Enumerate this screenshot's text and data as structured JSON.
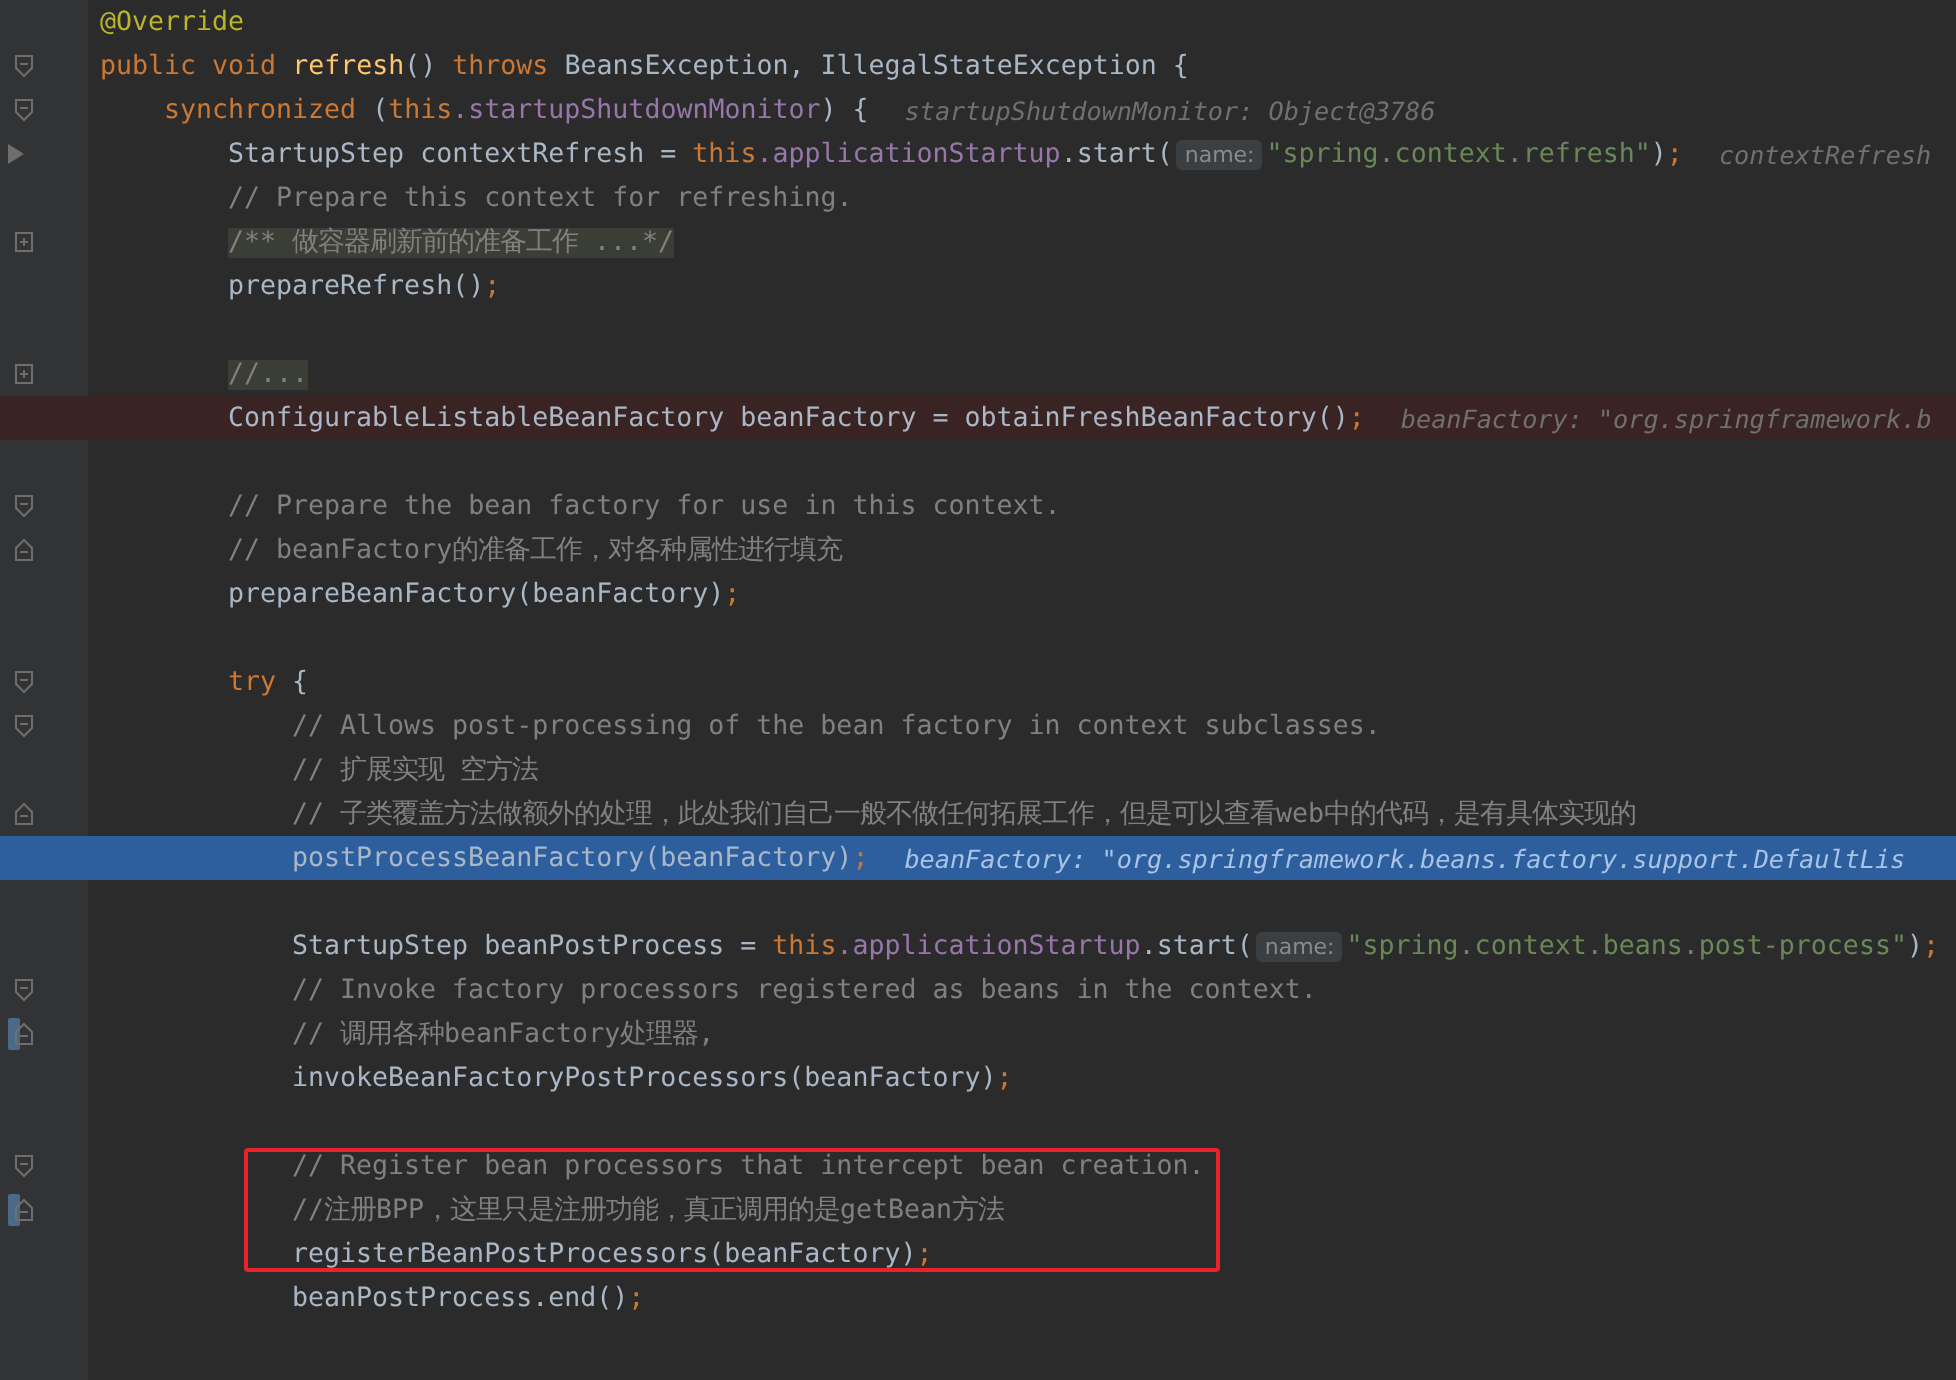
{
  "editor": {
    "lines": [
      {
        "kind": "code",
        "boxed": false,
        "segments": [
          {
            "kind": "code",
            "tokens": [
              {
                "kind": "annotation",
                "text": "@Override"
              }
            ]
          }
        ]
      },
      {
        "kind": "code",
        "boxed": false,
        "gutter": [
          {
            "kind": "fold-start"
          }
        ],
        "segments": [
          {
            "kind": "code",
            "tokens": [
              {
                "kind": "keyword",
                "text": "public void "
              },
              {
                "kind": "method",
                "text": "refresh"
              },
              {
                "kind": "plain",
                "text": "() "
              },
              {
                "kind": "keyword",
                "text": "throws "
              },
              {
                "kind": "plain",
                "text": "BeansException, IllegalStateException {"
              }
            ]
          }
        ],
        "children": [
          {
            "kind": "code",
            "boxed": false,
            "gutter": [
              {
                "kind": "fold-start"
              }
            ],
            "segments": [
              {
                "kind": "code",
                "tokens": [
                  {
                    "kind": "keyword",
                    "text": "synchronized "
                  },
                  {
                    "kind": "plain",
                    "text": "("
                  },
                  {
                    "kind": "keyword",
                    "text": "this"
                  },
                  {
                    "kind": "field",
                    "text": ".startupShutdownMonitor"
                  },
                  {
                    "kind": "plain",
                    "text": ") {"
                  }
                ]
              },
              {
                "kind": "value",
                "text": "startupShutdownMonitor: Object@3786"
              }
            ],
            "children": [
              {
                "kind": "code",
                "boxed": false,
                "gutter": [
                  {
                    "kind": "arrow"
                  }
                ],
                "segments": [
                  {
                    "kind": "code",
                    "tokens": [
                      {
                        "kind": "plain",
                        "text": "StartupStep contextRefresh = "
                      },
                      {
                        "kind": "keyword",
                        "text": "this"
                      },
                      {
                        "kind": "field",
                        "text": ".applicationStartup"
                      },
                      {
                        "kind": "plain",
                        "text": ".start("
                      }
                    ]
                  },
                  {
                    "kind": "hint",
                    "text": "name:"
                  },
                  {
                    "kind": "code",
                    "tokens": [
                      {
                        "kind": "string",
                        "text": "\"spring.context.refresh\""
                      },
                      {
                        "kind": "plain",
                        "text": ")"
                      },
                      {
                        "kind": "keyword",
                        "text": ";"
                      }
                    ]
                  },
                  {
                    "kind": "value",
                    "text": "contextRefresh"
                  }
                ]
              },
              {
                "kind": "code",
                "boxed": false,
                "segments": [
                  {
                    "kind": "code",
                    "tokens": [
                      {
                        "kind": "comment",
                        "text": "// Prepare this context for refreshing."
                      }
                    ]
                  }
                ]
              },
              {
                "kind": "code",
                "boxed": false,
                "gutter": [
                  {
                    "kind": "expand"
                  }
                ],
                "segments": [
                  {
                    "kind": "code",
                    "tokens": [
                      {
                        "kind": "folded",
                        "text": "/** 做容器刷新前的准备工作 ...*/"
                      }
                    ]
                  }
                ]
              },
              {
                "kind": "code",
                "boxed": false,
                "segments": [
                  {
                    "kind": "code",
                    "tokens": [
                      {
                        "kind": "plain",
                        "text": "prepareRefresh()"
                      },
                      {
                        "kind": "keyword",
                        "text": ";"
                      }
                    ]
                  }
                ]
              },
              {
                "kind": "blank",
                "boxed": false
              },
              {
                "kind": "code",
                "boxed": false,
                "gutter": [
                  {
                    "kind": "expand"
                  }
                ],
                "segments": [
                  {
                    "kind": "code",
                    "tokens": [
                      {
                        "kind": "folded",
                        "text": "//..."
                      }
                    ]
                  }
                ]
              },
              {
                "kind": "breakpoint",
                "boxed": false,
                "segments": [
                  {
                    "kind": "code",
                    "tokens": [
                      {
                        "kind": "plain",
                        "text": "ConfigurableListableBeanFactory beanFactory = obtainFreshBeanFactory()"
                      },
                      {
                        "kind": "keyword",
                        "text": ";"
                      }
                    ]
                  },
                  {
                    "kind": "value",
                    "text": "beanFactory: \"org.springframework.b"
                  }
                ]
              },
              {
                "kind": "blank",
                "boxed": false
              },
              {
                "kind": "code",
                "boxed": false,
                "gutter": [
                  {
                    "kind": "fold-start"
                  }
                ],
                "segments": [
                  {
                    "kind": "code",
                    "tokens": [
                      {
                        "kind": "comment",
                        "text": "// Prepare the bean factory for use in this context."
                      }
                    ]
                  }
                ]
              },
              {
                "kind": "code",
                "boxed": false,
                "gutter": [
                  {
                    "kind": "fold-end"
                  }
                ],
                "segments": [
                  {
                    "kind": "code",
                    "tokens": [
                      {
                        "kind": "comment",
                        "text": "// beanFactory的准备工作，对各种属性进行填充"
                      }
                    ]
                  }
                ]
              },
              {
                "kind": "code",
                "boxed": false,
                "segments": [
                  {
                    "kind": "code",
                    "tokens": [
                      {
                        "kind": "plain",
                        "text": "prepareBeanFactory(beanFactory)"
                      },
                      {
                        "kind": "keyword",
                        "text": ";"
                      }
                    ]
                  }
                ]
              },
              {
                "kind": "blank",
                "boxed": false
              },
              {
                "kind": "code",
                "boxed": false,
                "gutter": [
                  {
                    "kind": "fold-start"
                  }
                ],
                "segments": [
                  {
                    "kind": "code",
                    "tokens": [
                      {
                        "kind": "keyword",
                        "text": "try "
                      },
                      {
                        "kind": "plain",
                        "text": "{"
                      }
                    ]
                  }
                ],
                "children": [
                  {
                    "kind": "code",
                    "boxed": false,
                    "gutter": [
                      {
                        "kind": "fold-start"
                      }
                    ],
                    "segments": [
                      {
                        "kind": "code",
                        "tokens": [
                          {
                            "kind": "comment",
                            "text": "// Allows post-processing of the bean factory in context subclasses."
                          }
                        ]
                      }
                    ]
                  },
                  {
                    "kind": "code",
                    "boxed": false,
                    "segments": [
                      {
                        "kind": "code",
                        "tokens": [
                          {
                            "kind": "comment",
                            "text": "// 扩展实现 空方法"
                          }
                        ]
                      }
                    ]
                  },
                  {
                    "kind": "code",
                    "boxed": false,
                    "gutter": [
                      {
                        "kind": "fold-end"
                      }
                    ],
                    "segments": [
                      {
                        "kind": "code",
                        "tokens": [
                          {
                            "kind": "comment",
                            "text": "// 子类覆盖方法做额外的处理，此处我们自己一般不做任何拓展工作，但是可以查看web中的代码，是有具体实现的"
                          }
                        ]
                      }
                    ]
                  },
                  {
                    "kind": "execution",
                    "boxed": false,
                    "segments": [
                      {
                        "kind": "code",
                        "tokens": [
                          {
                            "kind": "plain",
                            "text": "postProcessBeanFactory(beanFactory)"
                          },
                          {
                            "kind": "keyword",
                            "text": ";"
                          }
                        ]
                      },
                      {
                        "kind": "value",
                        "text": "beanFactory: \"org.springframework.beans.factory.support.DefaultLis"
                      }
                    ]
                  },
                  {
                    "kind": "blank",
                    "boxed": false
                  },
                  {
                    "kind": "code",
                    "boxed": false,
                    "segments": [
                      {
                        "kind": "code",
                        "tokens": [
                          {
                            "kind": "plain",
                            "text": "StartupStep beanPostProcess = "
                          },
                          {
                            "kind": "keyword",
                            "text": "this"
                          },
                          {
                            "kind": "field",
                            "text": ".applicationStartup"
                          },
                          {
                            "kind": "plain",
                            "text": ".start("
                          }
                        ]
                      },
                      {
                        "kind": "hint",
                        "text": "name:"
                      },
                      {
                        "kind": "code",
                        "tokens": [
                          {
                            "kind": "string",
                            "text": "\"spring.context.beans.post-process\""
                          },
                          {
                            "kind": "plain",
                            "text": ")"
                          },
                          {
                            "kind": "keyword",
                            "text": ";"
                          }
                        ]
                      }
                    ]
                  },
                  {
                    "kind": "code",
                    "boxed": false,
                    "gutter": [
                      {
                        "kind": "fold-start"
                      }
                    ],
                    "segments": [
                      {
                        "kind": "code",
                        "tokens": [
                          {
                            "kind": "comment",
                            "text": "// Invoke factory processors registered as beans in the context."
                          }
                        ]
                      }
                    ]
                  },
                  {
                    "kind": "code",
                    "boxed": false,
                    "gutter": [
                      {
                        "kind": "change"
                      },
                      {
                        "kind": "fold-end"
                      }
                    ],
                    "segments": [
                      {
                        "kind": "code",
                        "tokens": [
                          {
                            "kind": "comment",
                            "text": "// 调用各种beanFactory处理器,"
                          }
                        ]
                      }
                    ]
                  },
                  {
                    "kind": "code",
                    "boxed": false,
                    "segments": [
                      {
                        "kind": "code",
                        "tokens": [
                          {
                            "kind": "plain",
                            "text": "invokeBeanFactoryPostProcessors(beanFactory)"
                          },
                          {
                            "kind": "keyword",
                            "text": ";"
                          }
                        ]
                      }
                    ]
                  },
                  {
                    "kind": "blank",
                    "boxed": false
                  },
                  {
                    "kind": "code",
                    "boxed": true,
                    "gutter": [
                      {
                        "kind": "fold-start"
                      }
                    ],
                    "segments": [
                      {
                        "kind": "code",
                        "tokens": [
                          {
                            "kind": "comment",
                            "text": "// Register bean processors that intercept bean creation."
                          }
                        ]
                      }
                    ]
                  },
                  {
                    "kind": "code",
                    "boxed": true,
                    "gutter": [
                      {
                        "kind": "change"
                      },
                      {
                        "kind": "fold-end"
                      }
                    ],
                    "segments": [
                      {
                        "kind": "code",
                        "tokens": [
                          {
                            "kind": "comment",
                            "text": "//注册BPP，这里只是注册功能，真正调用的是getBean方法"
                          }
                        ]
                      }
                    ]
                  },
                  {
                    "kind": "code",
                    "boxed": true,
                    "segments": [
                      {
                        "kind": "code",
                        "tokens": [
                          {
                            "kind": "plain",
                            "text": "registerBeanPostProcessors(beanFactory)"
                          },
                          {
                            "kind": "keyword",
                            "text": ";"
                          }
                        ]
                      }
                    ]
                  },
                  {
                    "kind": "code",
                    "boxed": false,
                    "segments": [
                      {
                        "kind": "code",
                        "tokens": [
                          {
                            "kind": "plain",
                            "text": "beanPostProcess.end()"
                          },
                          {
                            "kind": "keyword",
                            "text": ";"
                          }
                        ]
                      }
                    ]
                  }
                ]
              }
            ]
          }
        ]
      }
    ]
  }
}
